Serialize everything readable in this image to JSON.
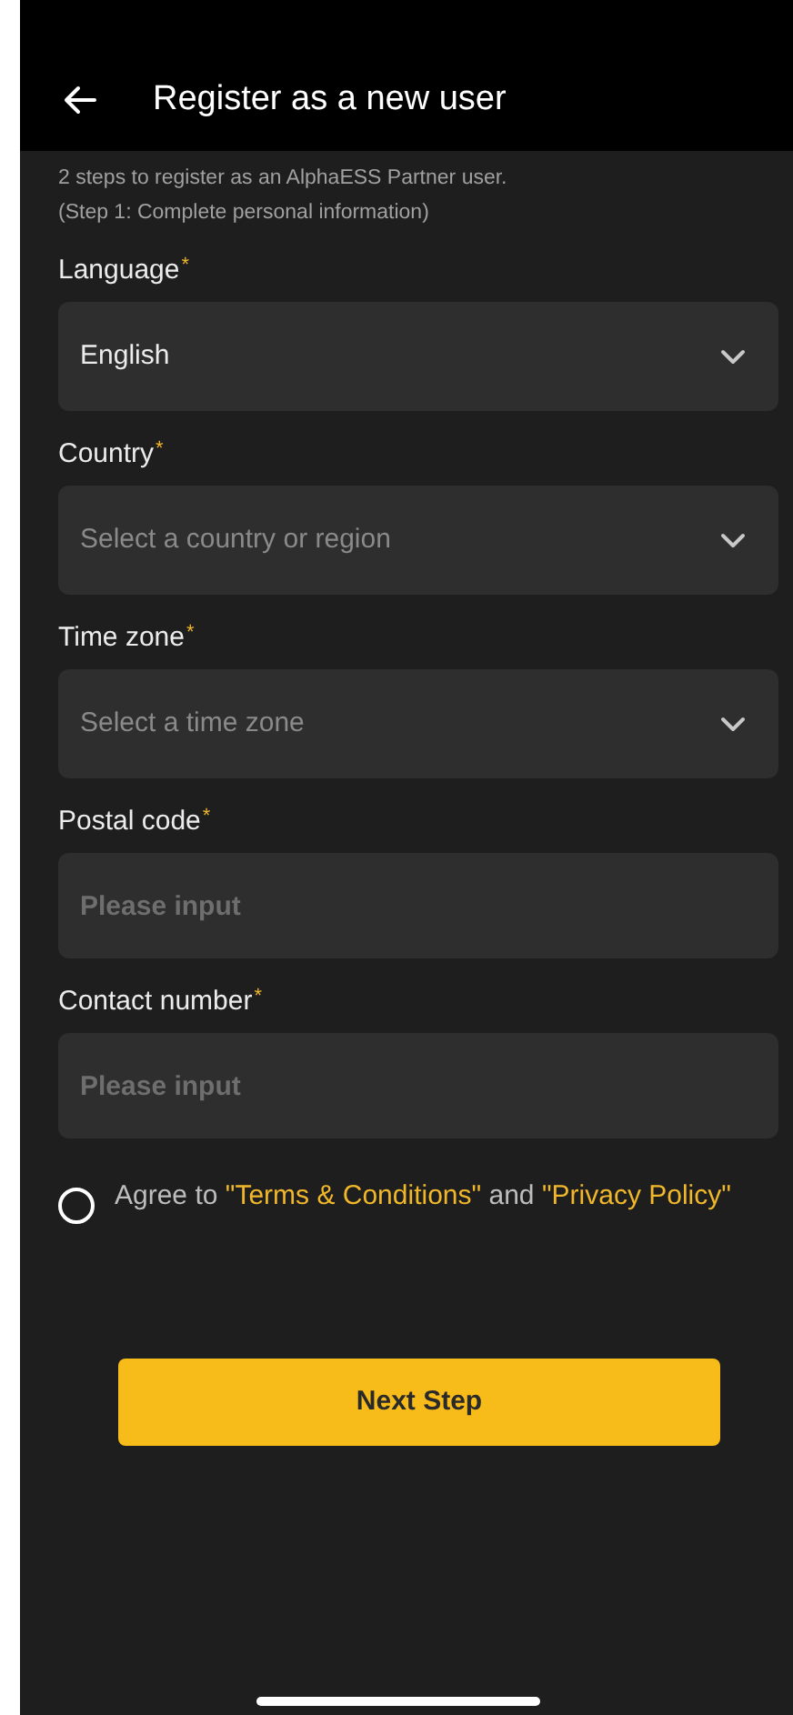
{
  "header": {
    "title": "Register as a new user"
  },
  "intro": [
    "2 steps to register as an AlphaESS Partner user.",
    "(Step 1: Complete personal information)"
  ],
  "fields": [
    {
      "kind": "select",
      "label": "Language",
      "required_mark": "*",
      "value": "English"
    },
    {
      "kind": "select",
      "label": "Country",
      "required_mark": "*",
      "placeholder": "Select a country or region"
    },
    {
      "kind": "select",
      "label": "Time zone",
      "required_mark": "*",
      "placeholder": "Select a time zone"
    },
    {
      "kind": "input",
      "label": "Postal code",
      "required_mark": "*",
      "placeholder": "Please input"
    },
    {
      "kind": "input",
      "label": "Contact number",
      "required_mark": "*",
      "placeholder": "Please input"
    }
  ],
  "agreement": {
    "checked": false,
    "parts": [
      {
        "kind": "text",
        "text": "Agree to "
      },
      {
        "kind": "link",
        "text": "\"Terms & Conditions\""
      },
      {
        "kind": "text",
        "text": " and "
      },
      {
        "kind": "link",
        "text": "\"Privacy Policy\""
      }
    ]
  },
  "next_button": "Next Step"
}
